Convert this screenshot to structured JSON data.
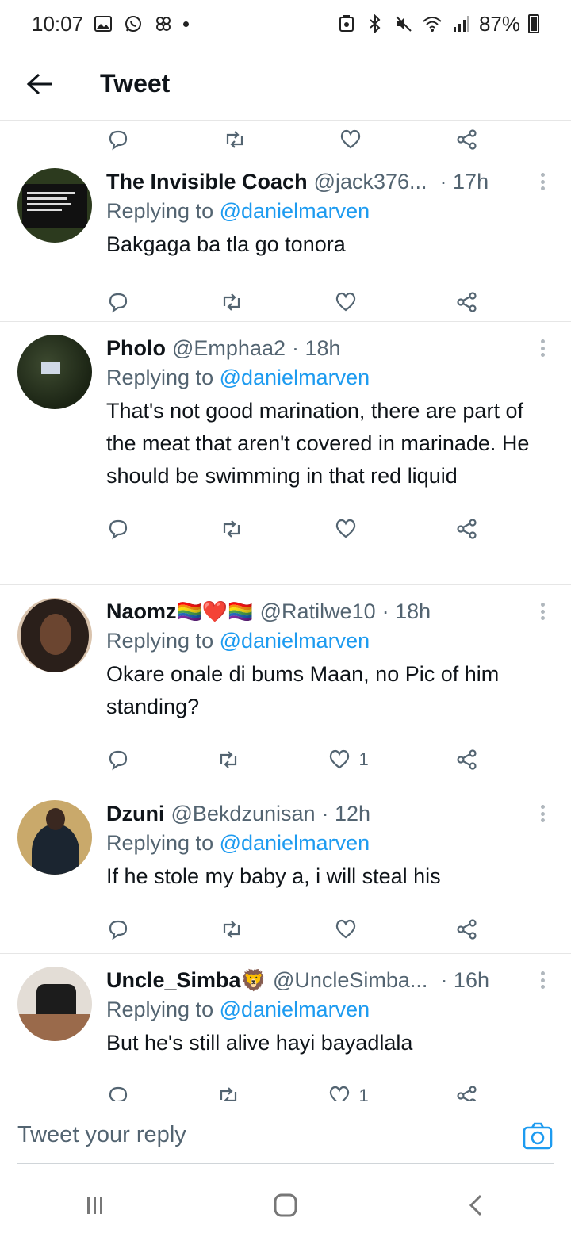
{
  "status_bar": {
    "time": "10:07",
    "battery": "87%"
  },
  "header": {
    "title": "Tweet"
  },
  "tweets": [
    {
      "name": "The Invisible Coach",
      "emoji": "",
      "handle": "@jack376...",
      "time": "· 17h",
      "replying_prefix": "Replying to ",
      "replying_to": "@danielmarven",
      "text": "Bakgaga ba tla go tonora",
      "likes": ""
    },
    {
      "name": "Pholo",
      "emoji": "",
      "handle": "@Emphaa2",
      "time": "· 18h",
      "replying_prefix": "Replying to ",
      "replying_to": "@danielmarven",
      "text": "That's not good marination, there are part of the meat that aren't covered in marinade. He should be swimming in that red liquid",
      "likes": ""
    },
    {
      "name": "Naomz",
      "emoji": "🏳️‍🌈❤️🏳️‍🌈",
      "handle": "@Ratilwe10",
      "time": "· 18h",
      "replying_prefix": "Replying to ",
      "replying_to": "@danielmarven",
      "text": "Okare onale di bums Maan, no Pic of him standing?",
      "likes": "1"
    },
    {
      "name": "Dzuni",
      "emoji": "",
      "handle": "@Bekdzunisan",
      "time": "· 12h",
      "replying_prefix": "Replying to ",
      "replying_to": "@danielmarven",
      "text": "If he stole my baby a, i will steal his",
      "likes": ""
    },
    {
      "name": "Uncle_Simba",
      "emoji": "🦁",
      "handle": "@UncleSimba...",
      "time": "· 16h",
      "replying_prefix": "Replying to ",
      "replying_to": "@danielmarven",
      "text": "But he's still alive hayi bayadlala",
      "likes": "1"
    }
  ],
  "avatar_texts": {
    "coach": "When a flower doesn't bloom you fix the environment in which it grows, not the flower."
  },
  "composer": {
    "placeholder": "Tweet your reply"
  },
  "colors": {
    "accent": "#1d9bf0",
    "secondary_text": "#536471",
    "divider": "#e6e6e6"
  },
  "icons": {
    "reply": "reply-icon",
    "retweet": "retweet-icon",
    "like": "heart-icon",
    "share": "share-icon",
    "more": "more-vertical-icon",
    "camera": "camera-icon",
    "back": "back-arrow-icon"
  }
}
